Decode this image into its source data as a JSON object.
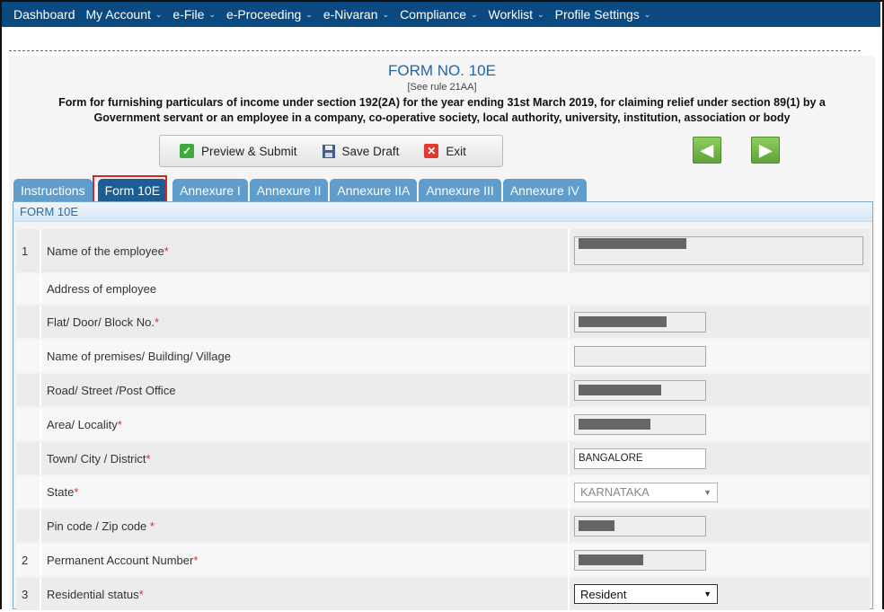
{
  "nav": {
    "items": [
      {
        "label": "Dashboard",
        "dropdown": false
      },
      {
        "label": "My Account",
        "dropdown": true
      },
      {
        "label": "e-File",
        "dropdown": true
      },
      {
        "label": "e-Proceeding",
        "dropdown": true
      },
      {
        "label": "e-Nivaran",
        "dropdown": true
      },
      {
        "label": "Compliance",
        "dropdown": true
      },
      {
        "label": "Worklist",
        "dropdown": true
      },
      {
        "label": "Profile Settings",
        "dropdown": true
      }
    ]
  },
  "header": {
    "title": "FORM NO. 10E",
    "rule": "[See rule 21AA]",
    "description": "Form for furnishing particulars of income under section 192(2A) for the year ending 31st March 2019, for claiming relief under section 89(1) by a Government servant or an employee in a company, co-operative society, local authority, university, institution, association or body"
  },
  "toolbar": {
    "preview_label": "Preview & Submit",
    "save_label": "Save Draft",
    "exit_label": "Exit",
    "prev_icon": "left-arrow-icon",
    "next_icon": "right-arrow-icon"
  },
  "tabs": [
    "Instructions",
    "Form 10E",
    "Annexure I",
    "Annexure II",
    "Annexure IIA",
    "Annexure III",
    "Annexure IV"
  ],
  "active_tab": "Form 10E",
  "section_title": "FORM 10E",
  "rows": {
    "employee_name": {
      "num": "1",
      "label": "Name of the employee"
    },
    "address_heading": {
      "label": "Address of employee"
    },
    "flat": {
      "label": "Flat/ Door/ Block No."
    },
    "premises": {
      "label": "Name of premises/ Building/ Village"
    },
    "road": {
      "label": "Road/ Street /Post Office"
    },
    "area": {
      "label": "Area/ Locality"
    },
    "town": {
      "label": "Town/ City / District",
      "value": "BANGALORE"
    },
    "state": {
      "label": "State",
      "value": "KARNATAKA"
    },
    "pin": {
      "label": "Pin code / Zip code "
    },
    "pan": {
      "num": "2",
      "label": "Permanent Account Number"
    },
    "residential": {
      "num": "3",
      "label": "Residential status",
      "value": "Resident"
    }
  },
  "required_mark": "*",
  "colors": {
    "nav_bg": "#0b4a80",
    "tab_bg": "#5f9dcc",
    "tab_active_bg": "#1c5d94",
    "highlight": "#d8242a",
    "required": "#d9302f"
  }
}
